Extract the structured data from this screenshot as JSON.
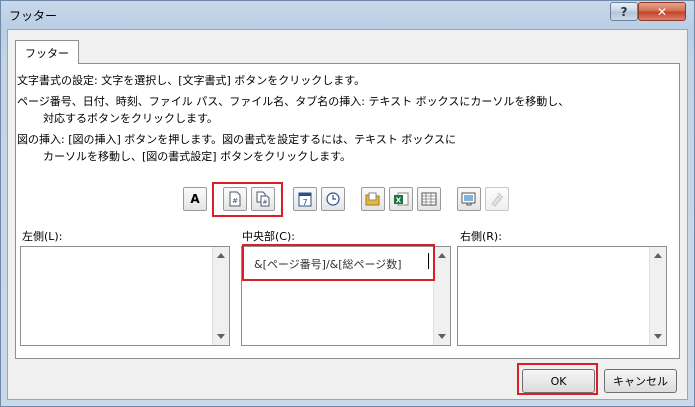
{
  "window": {
    "title": "フッター",
    "help_label": "?",
    "close_label": "✕"
  },
  "tabs": [
    {
      "label": "フッター"
    }
  ],
  "instructions": {
    "line1": "文字書式の設定: 文字を選択し、[文字書式] ボタンをクリックします。",
    "line2": "ページ番号、日付、時刻、ファイル パス、ファイル名、タブ名の挿入: テキスト ボックスにカーソルを移動し、",
    "line3": "対応するボタンをクリックします。",
    "line4": "図の挿入: [図の挿入] ボタンを押します。図の書式を設定するには、テキスト ボックスに",
    "line5": "カーソルを移動し、[図の書式設定] ボタンをクリックします。"
  },
  "toolbar": {
    "format_text_glyph": "A",
    "date_number": "7"
  },
  "sections": {
    "left_label": "左側(L):",
    "center_label": "中央部(C):",
    "right_label": "右側(R):",
    "center_value": "&[ページ番号]/&[総ページ数]",
    "left_value": "",
    "right_value": ""
  },
  "buttons": {
    "ok": "OK",
    "cancel": "キャンセル"
  },
  "colors": {
    "highlight": "#d8202a",
    "excel_green": "#1f7244",
    "folder_yellow": "#e8b83c"
  }
}
